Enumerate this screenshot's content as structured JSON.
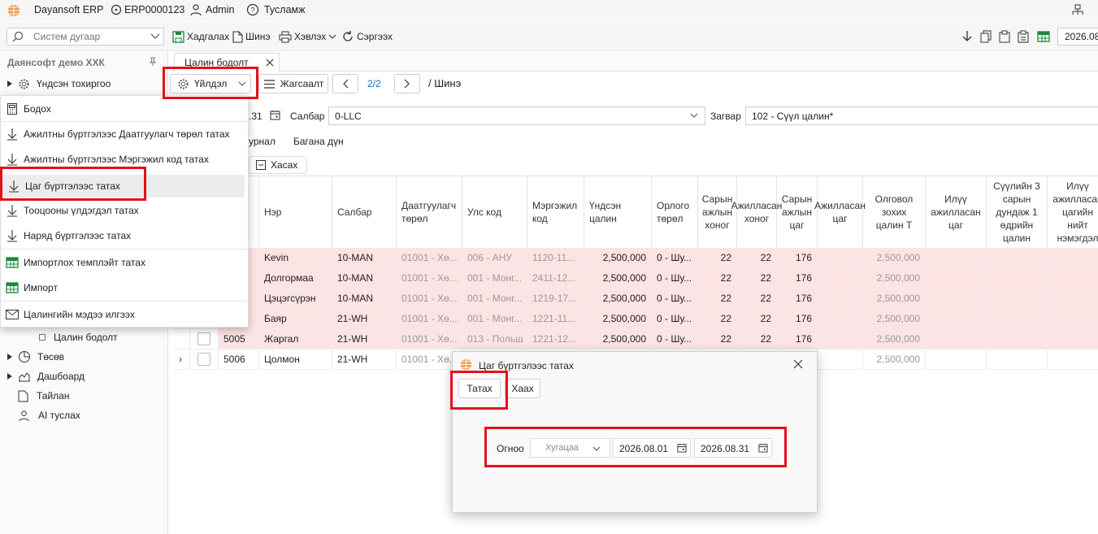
{
  "app": {
    "name": "Dayansoft ERP",
    "db": "ERP0000123",
    "user": "Admin",
    "help": "Тусламж"
  },
  "toolbar": {
    "search_placeholder": "Систем дугаар",
    "save": "Хадгалах",
    "new": "Шинэ",
    "print": "Хэвлэх",
    "refresh": "Сэргээх",
    "date": "2026.08"
  },
  "sidebar": {
    "company": "Даянсофт демо ХХК",
    "items": [
      "Үндсэн тохиргоо",
      "Цалин бодолт",
      "Төсөв",
      "Дашбоард",
      "Тайлан",
      "AI туслах"
    ]
  },
  "tab": {
    "label": "Цалин бодолт"
  },
  "actions": {
    "action": "Үйлдэл",
    "list": "Жагсаалт",
    "pager": "2/2",
    "status": "/ Шинэ"
  },
  "filters": {
    "date_partial": ".31",
    "branch_label": "Салбар",
    "branch_value": "0-LLC",
    "template_label": "Загвар",
    "template_value": "102 - Сүүл цалин*"
  },
  "subtabs": {
    "journal": "урнал",
    "column_sum": "Багана дүн",
    "delete": "Хасах"
  },
  "menu": {
    "items": [
      "Бодох",
      "Ажилтны бүртгэлээс Даатгуулагч төрөл татах",
      "Ажилтны бүртгэлээс Мэргэжил код татах",
      "Цаг бүртгэлээс татах",
      "Тооцооны үлдэгдэл татах",
      "Наряд бүртгэлээс татах",
      "Импортлох темплэйт татах",
      "Импорт",
      "Цалингийн мэдээ илгээх"
    ]
  },
  "grid": {
    "headers": [
      "Нэр",
      "Салбар",
      "Даатгуулагч төрөл",
      "Улс код",
      "Мэргэжил код",
      "Үндсэн цалин",
      "Орлого төрөл",
      "Сарын ажлын хоног",
      "Ажилласан хоног",
      "Сарын ажлын цаг",
      "Ажилласан цаг",
      "Олговол зохих цалин Т",
      "Илүү ажилласан цаг",
      "Сүүлийн 3 сарын дундаж 1 өдрийн цалин",
      "Илүү ажилласан цагийн нийт нэмэгдэл"
    ],
    "rows": [
      {
        "code": "",
        "name": "Kevin",
        "branch": "10-MAN",
        "ins": "01001 - Хө...",
        "country": "006 - АНУ",
        "prof": "1120-11...",
        "salary": "2,500,000",
        "income": "0 - Шу...",
        "mdays": "22",
        "wdays": "22",
        "mhours": "176",
        "whours": "",
        "pay": "2,500,000"
      },
      {
        "code": "",
        "name": "Долгормаа",
        "branch": "10-MAN",
        "ins": "01001 - Хө...",
        "country": "001 - Монг...",
        "prof": "2411-12...",
        "salary": "2,500,000",
        "income": "0 - Шу...",
        "mdays": "22",
        "wdays": "22",
        "mhours": "176",
        "whours": "",
        "pay": "2,500,000"
      },
      {
        "code": "",
        "name": "Цэцэгсүрэн",
        "branch": "10-MAN",
        "ins": "01001 - Хө...",
        "country": "001 - Монг...",
        "prof": "1219-17...",
        "salary": "2,500,000",
        "income": "0 - Шу...",
        "mdays": "22",
        "wdays": "22",
        "mhours": "176",
        "whours": "",
        "pay": "2,500,000"
      },
      {
        "code": "",
        "name": "Баяр",
        "branch": "21-WH",
        "ins": "01001 - Хө...",
        "country": "001 - Монг...",
        "prof": "1221-11...",
        "salary": "2,500,000",
        "income": "0 - Шу...",
        "mdays": "22",
        "wdays": "22",
        "mhours": "176",
        "whours": "",
        "pay": "2,500,000"
      },
      {
        "code": "5005",
        "name": "Жаргал",
        "branch": "21-WH",
        "ins": "01001 - Хө...",
        "country": "013 - Польш",
        "prof": "1221-12...",
        "salary": "2,500,000",
        "income": "0 - Шу...",
        "mdays": "22",
        "wdays": "22",
        "mhours": "176",
        "whours": "",
        "pay": "2,500,000"
      },
      {
        "code": "5006",
        "name": "Цолмон",
        "branch": "21-WH",
        "ins": "01001 - Хө...",
        "country": "",
        "prof": "",
        "salary": "",
        "income": "",
        "mdays": "",
        "wdays": "",
        "mhours": "",
        "whours": "",
        "pay": "2,500,000"
      }
    ]
  },
  "dialog": {
    "title": "Цаг бүртгэлээс татах",
    "fetch": "Татах",
    "close": "Хаах",
    "date_label": "Огноо",
    "period": "Хугацаа",
    "from": "2026.08.01",
    "to": "2026.08.31"
  },
  "colors": {
    "row_highlight": "#fde4e4",
    "accent_red": "#e3121b",
    "link_blue": "#1f6fb2"
  }
}
